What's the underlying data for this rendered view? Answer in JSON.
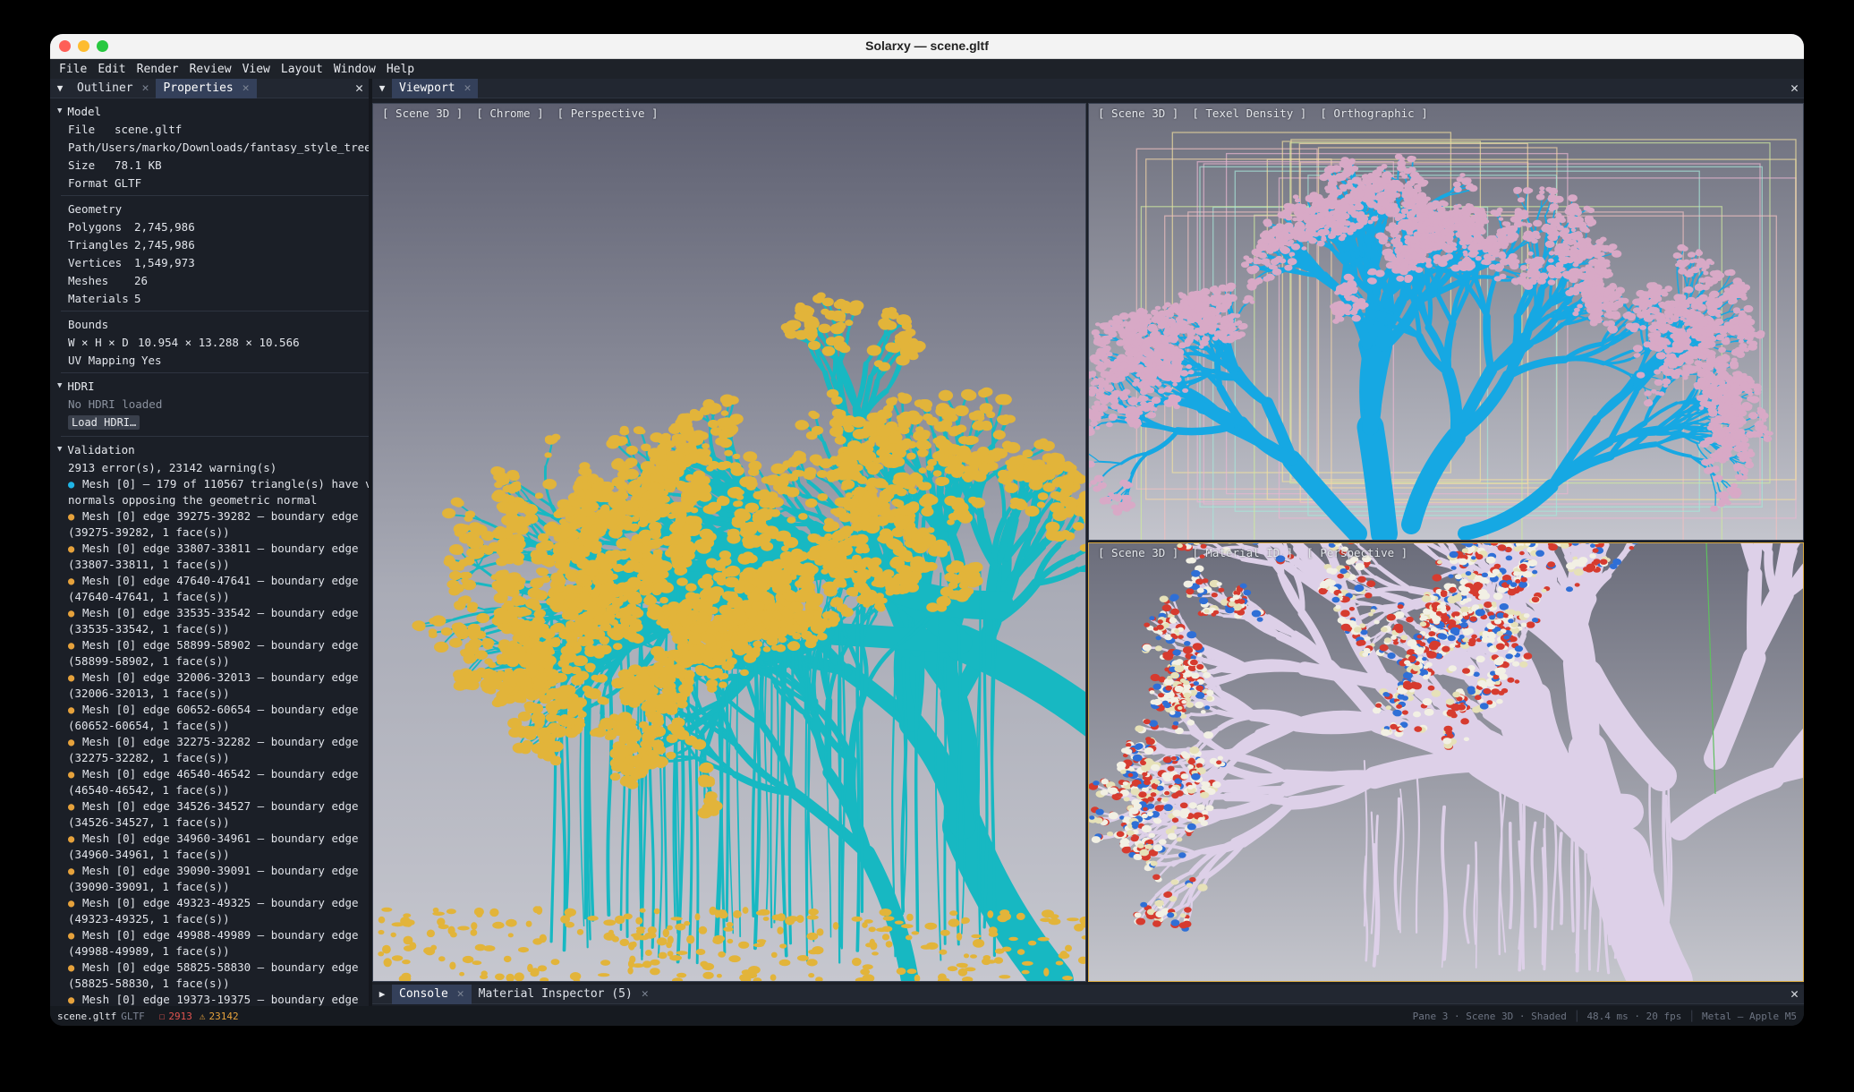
{
  "window": {
    "title": "Solarxy — scene.gltf"
  },
  "colors": {
    "close": "#fe5f57",
    "minimize": "#febc2e",
    "maximize": "#28c840",
    "accent": "#34405a",
    "error": "#e0544f",
    "warning": "#e6a23c",
    "info": "#1fb5e6"
  },
  "menu": [
    "File",
    "Edit",
    "Render",
    "Review",
    "View",
    "Layout",
    "Window",
    "Help"
  ],
  "left_tabs": {
    "toggle": "▼",
    "outliner": "Outliner",
    "properties": "Properties"
  },
  "model": {
    "title": "Model",
    "file_label": "File",
    "file_value": "scene.gltf",
    "path_label": "Path",
    "path_value": "/Users/marko/Downloads/fantasy_style_tree",
    "size_label": "Size",
    "size_value": "78.1 KB",
    "format_label": "Format",
    "format_value": "GLTF"
  },
  "geometry": {
    "title": "Geometry",
    "polygons_label": "Polygons",
    "polygons_value": "2,745,986",
    "triangles_label": "Triangles",
    "triangles_value": "2,745,986",
    "vertices_label": "Vertices",
    "vertices_value": "1,549,973",
    "meshes_label": "Meshes",
    "meshes_value": "26",
    "materials_label": "Materials",
    "materials_value": "5"
  },
  "bounds": {
    "title": "Bounds",
    "whd_label": "W × H × D",
    "whd_value": "10.954 × 13.288 × 10.566",
    "uv_label": "UV Mapping",
    "uv_value": "Yes"
  },
  "hdri": {
    "title": "HDRI",
    "status": "No HDRI loaded",
    "load_button": "Load HDRI…"
  },
  "validation": {
    "title": "Validation",
    "summary": "2913 error(s), 23142 warning(s)",
    "items": [
      {
        "kind": "info",
        "line1": "Mesh [0] — 179 of 110567 triangle(s) have v",
        "line2": "normals opposing the geometric normal"
      },
      {
        "kind": "warn",
        "line1": "Mesh [0] edge 39275-39282 — boundary edge",
        "line2": "(39275-39282, 1 face(s))"
      },
      {
        "kind": "warn",
        "line1": "Mesh [0] edge 33807-33811 — boundary edge",
        "line2": "(33807-33811, 1 face(s))"
      },
      {
        "kind": "warn",
        "line1": "Mesh [0] edge 47640-47641 — boundary edge",
        "line2": "(47640-47641, 1 face(s))"
      },
      {
        "kind": "warn",
        "line1": "Mesh [0] edge 33535-33542 — boundary edge",
        "line2": "(33535-33542, 1 face(s))"
      },
      {
        "kind": "warn",
        "line1": "Mesh [0] edge 58899-58902 — boundary edge",
        "line2": "(58899-58902, 1 face(s))"
      },
      {
        "kind": "warn",
        "line1": "Mesh [0] edge 32006-32013 — boundary edge",
        "line2": "(32006-32013, 1 face(s))"
      },
      {
        "kind": "warn",
        "line1": "Mesh [0] edge 60652-60654 — boundary edge",
        "line2": "(60652-60654, 1 face(s))"
      },
      {
        "kind": "warn",
        "line1": "Mesh [0] edge 32275-32282 — boundary edge",
        "line2": "(32275-32282, 1 face(s))"
      },
      {
        "kind": "warn",
        "line1": "Mesh [0] edge 46540-46542 — boundary edge",
        "line2": "(46540-46542, 1 face(s))"
      },
      {
        "kind": "warn",
        "line1": "Mesh [0] edge 34526-34527 — boundary edge",
        "line2": "(34526-34527, 1 face(s))"
      },
      {
        "kind": "warn",
        "line1": "Mesh [0] edge 34960-34961 — boundary edge",
        "line2": "(34960-34961, 1 face(s))"
      },
      {
        "kind": "warn",
        "line1": "Mesh [0] edge 39090-39091 — boundary edge",
        "line2": "(39090-39091, 1 face(s))"
      },
      {
        "kind": "warn",
        "line1": "Mesh [0] edge 49323-49325 — boundary edge",
        "line2": "(49323-49325, 1 face(s))"
      },
      {
        "kind": "warn",
        "line1": "Mesh [0] edge 49988-49989 — boundary edge",
        "line2": "(49988-49989, 1 face(s))"
      },
      {
        "kind": "warn",
        "line1": "Mesh [0] edge 58825-58830 — boundary edge",
        "line2": "(58825-58830, 1 face(s))"
      },
      {
        "kind": "warn",
        "line1": "Mesh [0] edge 19373-19375 — boundary edge",
        "line2": ""
      }
    ]
  },
  "viewport": {
    "tab": "Viewport",
    "pane1": {
      "label": "[ Scene 3D ]  [ Chrome ]  [ Perspective ]"
    },
    "pane2": {
      "label": "[ Scene 3D ]  [ Texel Density ]  [ Orthographic ]"
    },
    "pane3": {
      "label": "[ Scene 3D ]  [ Material ID ]  [ Perspective ]"
    }
  },
  "bottom_tabs": {
    "toggle": "▶",
    "console": "Console",
    "material_inspector": "Material Inspector (5)"
  },
  "status": {
    "file": "scene.gltf",
    "format": "GLTF",
    "errors": "2913",
    "warnings": "23142",
    "pane": "Pane 3 · Scene 3D · Shaded",
    "timing": "48.4 ms · 20 fps",
    "backend": "Metal — Apple M5"
  }
}
